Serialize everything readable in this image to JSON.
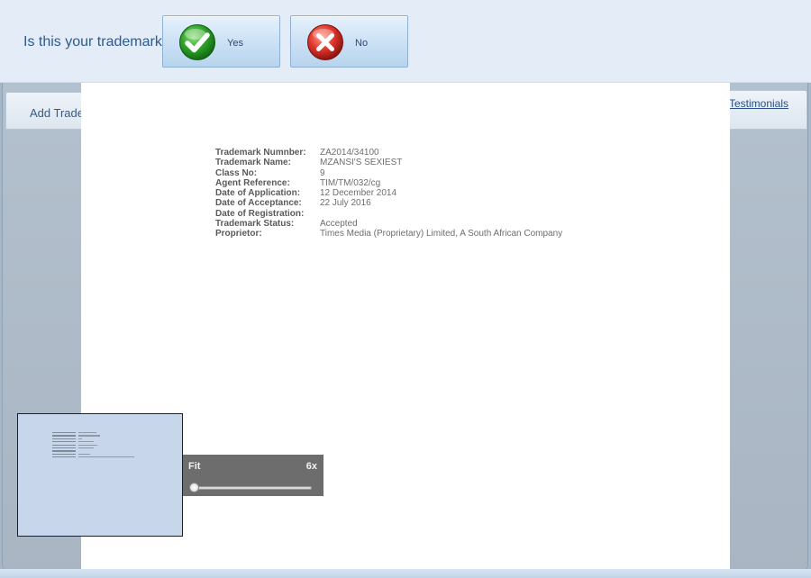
{
  "confirm": {
    "question": "Is this your trademark?",
    "yes_label": "Yes",
    "no_label": "No"
  },
  "background": {
    "left_tab_label": "Add Trade",
    "right_tab_label": "Testimonials"
  },
  "trademark": {
    "rows": [
      {
        "label": "Trademark Numnber:",
        "value": "ZA2014/34100"
      },
      {
        "label": "Trademark Name:",
        "value": "MZANSI'S SEXIEST"
      },
      {
        "label": "Class No:",
        "value": "9"
      },
      {
        "label": "Agent Reference:",
        "value": "TIM/TM/032/cg"
      },
      {
        "label": "Date of Application:",
        "value": "12 December 2014"
      },
      {
        "label": "Date of Acceptance:",
        "value": "22 July 2016"
      },
      {
        "label": "Date of Registration:",
        "value": ""
      },
      {
        "label": "Trademark Status:",
        "value": "Accepted"
      },
      {
        "label": "Proprietor:",
        "value": "Times Media (Proprietary) Limited, A South African Company"
      }
    ]
  },
  "zoom": {
    "min_label": "Fit",
    "max_label": "6x",
    "level": 0
  },
  "colors": {
    "accent": "#2b5b92",
    "yes_green": "#2e9a2e",
    "no_red": "#d9302a"
  }
}
